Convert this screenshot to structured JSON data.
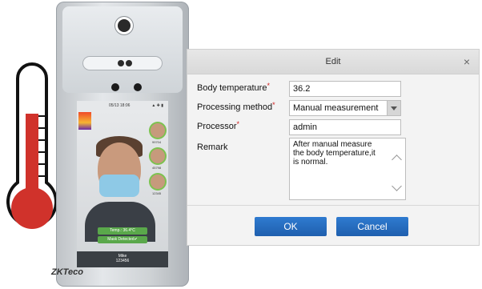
{
  "device": {
    "brand": "ZKTeco",
    "screen": {
      "date_time": "05/13 18:06",
      "avatars": [
        {
          "id": "99704"
        },
        {
          "id": "45798"
        },
        {
          "id": "12345"
        }
      ],
      "temperature_chip": "Temp.: 36.4°C",
      "mask_chip": "Mask Detected✔",
      "bottom": {
        "name": "Mike",
        "id": "123456"
      }
    }
  },
  "dialog": {
    "title": "Edit",
    "close": "×",
    "fields": {
      "body_temperature": {
        "label": "Body temperature",
        "value": "36.2"
      },
      "processing_method": {
        "label": "Processing method",
        "value": "Manual measurement"
      },
      "processor": {
        "label": "Processor",
        "value": "admin"
      },
      "remark": {
        "label": "Remark",
        "value": "After manual measure the body temperature,it is normal."
      }
    },
    "required_mark": "*",
    "buttons": {
      "ok": "OK",
      "cancel": "Cancel"
    }
  },
  "icons": [
    "thermometer-icon",
    "camera-icon",
    "dropdown-arrow-icon",
    "close-icon"
  ],
  "colors": {
    "button_blue": "#1f5fae",
    "mercury_red": "#d0322b",
    "mask_blue": "#8ec9e6",
    "mask_green": "#5aa84b"
  }
}
